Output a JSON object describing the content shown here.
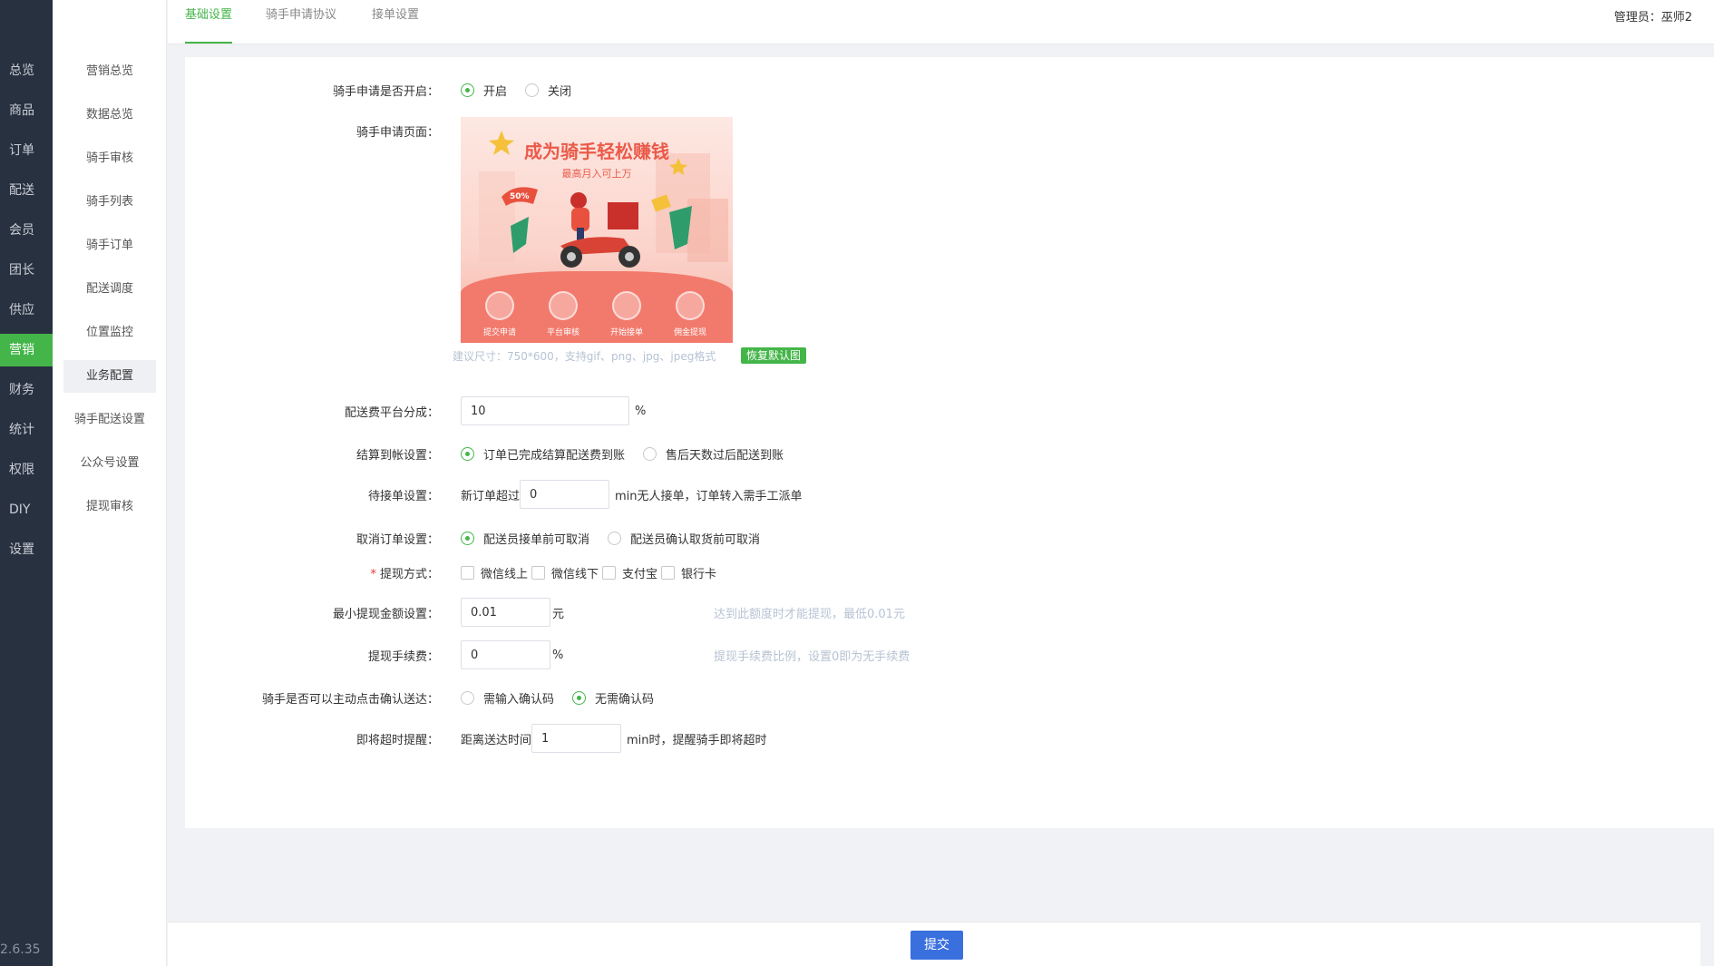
{
  "nav": {
    "items": [
      "总览",
      "商品",
      "订单",
      "配送",
      "会员",
      "团长",
      "供应",
      "营销",
      "财务",
      "统计",
      "权限",
      "DIY",
      "设置"
    ],
    "active_index": 7,
    "version": "2.6.35"
  },
  "subnav": {
    "items": [
      "营销总览",
      "数据总览",
      "骑手审核",
      "骑手列表",
      "骑手订单",
      "配送调度",
      "位置监控",
      "业务配置",
      "骑手配送设置",
      "公众号设置",
      "提现审核"
    ],
    "active_index": 7
  },
  "tabs": [
    "基础设置",
    "骑手申请协议",
    "接单设置"
  ],
  "active_tab": 0,
  "admin_label": "管理员：",
  "admin_name": "巫师2",
  "form": {
    "apply_open": {
      "label": "骑手申请是否开启：",
      "options": [
        "开启",
        "关闭"
      ],
      "selected": 0
    },
    "apply_page": {
      "label": "骑手申请页面：",
      "banner_title": "成为骑手轻松赚钱",
      "banner_sub": "最高月入可上万",
      "banner_badge": "50%",
      "banner_steps": [
        "提交申请",
        "平台审核",
        "开始接单",
        "佣金提现"
      ],
      "hint": "建议尺寸：750*600，支持gif、png、jpg、jpeg格式",
      "restore_label": "恢复默认图"
    },
    "platform_share": {
      "label": "配送费平台分成：",
      "value": "10",
      "unit": "%"
    },
    "settle": {
      "label": "结算到帐设置：",
      "options": [
        "订单已完成结算配送费到账",
        "售后天数过后配送到账"
      ],
      "selected": 0
    },
    "pending": {
      "label": "待接单设置：",
      "prefix": "新订单超过",
      "value": "0",
      "suffix": "min无人接单，订单转入需手工派单"
    },
    "cancel": {
      "label": "取消订单设置：",
      "options": [
        "配送员接单前可取消",
        "配送员确认取货前可取消"
      ],
      "selected": 0
    },
    "withdraw_method": {
      "label": "提现方式：",
      "required_mark": "*",
      "options": [
        "微信线上",
        "微信线下",
        "支付宝",
        "银行卡"
      ]
    },
    "min_withdraw": {
      "label": "最小提现金额设置：",
      "value": "0.01",
      "unit": "元",
      "hint": "达到此额度时才能提现，最低0.01元"
    },
    "withdraw_fee": {
      "label": "提现手续费：",
      "value": "0",
      "unit": "%",
      "hint": "提现手续费比例，设置0即为无手续费"
    },
    "confirm_delivery": {
      "label": "骑手是否可以主动点击确认送达：",
      "options": [
        "需输入确认码",
        "无需确认码"
      ],
      "selected": 1
    },
    "timeout_remind": {
      "label": "即将超时提醒：",
      "prefix": "距离送达时间",
      "value": "1",
      "suffix": "min时，提醒骑手即将超时"
    }
  },
  "submit_label": "提交",
  "colors": {
    "primary": "#44b549",
    "sidebar": "#283140",
    "submit": "#3a6fde"
  }
}
